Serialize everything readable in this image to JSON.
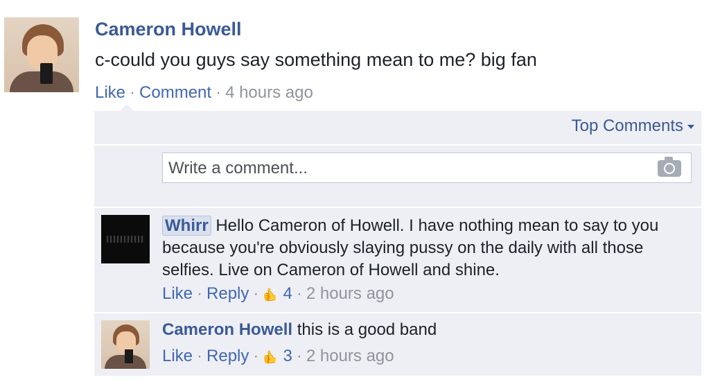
{
  "post": {
    "author": "Cameron Howell",
    "text": "c-could you guys say something mean to me? big fan",
    "like_label": "Like",
    "comment_label": "Comment",
    "timestamp": "4 hours ago"
  },
  "comments_panel": {
    "sort_label": "Top Comments",
    "composer_placeholder": "Write a comment..."
  },
  "comments": [
    {
      "author": "Whirr",
      "text": "Hello Cameron of Howell. I have nothing mean to say to you because you're obviously slaying pussy on the daily with all those selfies. Live on Cameron of Howell and shine.",
      "like_label": "Like",
      "reply_label": "Reply",
      "likes": "4",
      "timestamp": "2 hours ago"
    },
    {
      "author": "Cameron Howell",
      "text": "this is a good band",
      "like_label": "Like",
      "reply_label": "Reply",
      "likes": "3",
      "timestamp": "2 hours ago"
    }
  ],
  "separator": "·",
  "colors": {
    "link": "#3b5998",
    "meta": "#90949c",
    "panel": "#edeff4"
  },
  "icons": [
    "camera-icon",
    "thumbs-up-icon",
    "chevron-down-icon"
  ]
}
